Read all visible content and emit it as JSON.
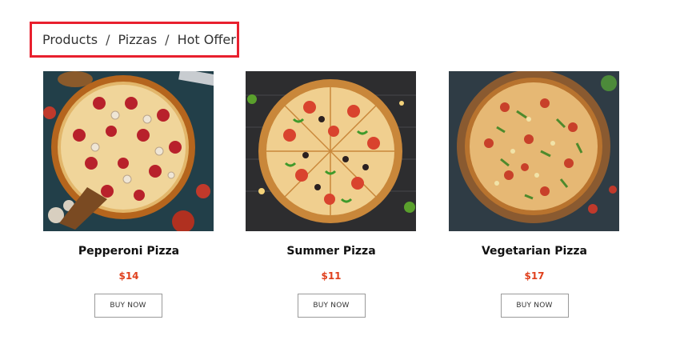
{
  "breadcrumb": {
    "items": [
      "Products",
      "Pizzas",
      "Hot Offer"
    ],
    "separator": "/"
  },
  "products": [
    {
      "name": "Pepperoni Pizza",
      "price": "$14",
      "button": "BUY NOW",
      "image": "pepperoni-pizza-photo"
    },
    {
      "name": "Summer Pizza",
      "price": "$11",
      "button": "BUY NOW",
      "image": "summer-pizza-photo"
    },
    {
      "name": "Vegetarian Pizza",
      "price": "$17",
      "button": "BUY NOW",
      "image": "vegetarian-pizza-photo"
    }
  ],
  "colors": {
    "highlight_border": "#e8202e",
    "price": "#e0401d",
    "button_border": "#9a9a9a"
  }
}
